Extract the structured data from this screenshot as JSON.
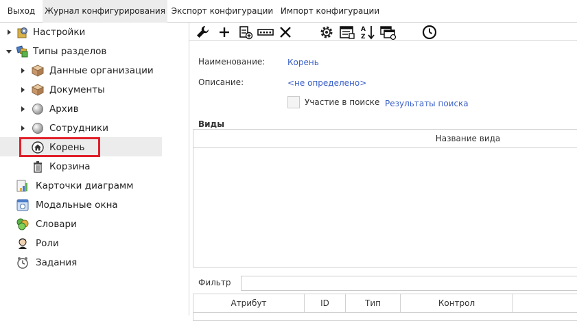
{
  "topbar": {
    "tabs": [
      {
        "label": "Выход"
      },
      {
        "label": "Журнал конфигурирования"
      },
      {
        "label": "Экспорт конфигурации"
      },
      {
        "label": "Импорт конфигурации"
      }
    ],
    "active_tab": 1
  },
  "sidebar": {
    "items": [
      {
        "label": "Настройки",
        "icon": "settings-icon"
      },
      {
        "label": "Типы разделов",
        "icon": "section-types-icon"
      },
      {
        "label": "Данные организации",
        "icon": "box-icon"
      },
      {
        "label": "Документы",
        "icon": "box-icon"
      },
      {
        "label": "Архив",
        "icon": "sphere-icon"
      },
      {
        "label": "Сотрудники",
        "icon": "sphere-icon"
      },
      {
        "label": "Корень",
        "icon": "home-icon"
      },
      {
        "label": "Корзина",
        "icon": "trash-icon"
      },
      {
        "label": "Карточки диаграмм",
        "icon": "chart-cards-icon"
      },
      {
        "label": "Модальные окна",
        "icon": "modal-window-icon"
      },
      {
        "label": "Словари",
        "icon": "dictionary-icon"
      },
      {
        "label": "Роли",
        "icon": "roles-icon"
      },
      {
        "label": "Задания",
        "icon": "tasks-clock-icon"
      }
    ],
    "selected_index": 6
  },
  "toolbar": {
    "icons": [
      "wrench-icon",
      "add-icon",
      "add-record-icon",
      "field-icon",
      "delete-icon",
      "settings-gear-icon",
      "card-view-icon",
      "sort-az-icon",
      "copy-window-icon",
      "clock-icon"
    ]
  },
  "form": {
    "name_label": "Наименование:",
    "name_value": "Корень",
    "description_label": "Описание:",
    "description_value": "<не определено>",
    "search_checkbox_label": "Участие в поиске",
    "search_results_link": "Результаты поиска"
  },
  "views": {
    "title": "Виды",
    "column_header": "Название вида"
  },
  "filter": {
    "label": "Фильтр",
    "value": ""
  },
  "attributes_table": {
    "columns": [
      "Атрибут",
      "ID",
      "Тип",
      "Контрол"
    ]
  },
  "colors": {
    "highlight": "#e0202a",
    "link": "#3a5fc7",
    "selection": "#ececec"
  }
}
